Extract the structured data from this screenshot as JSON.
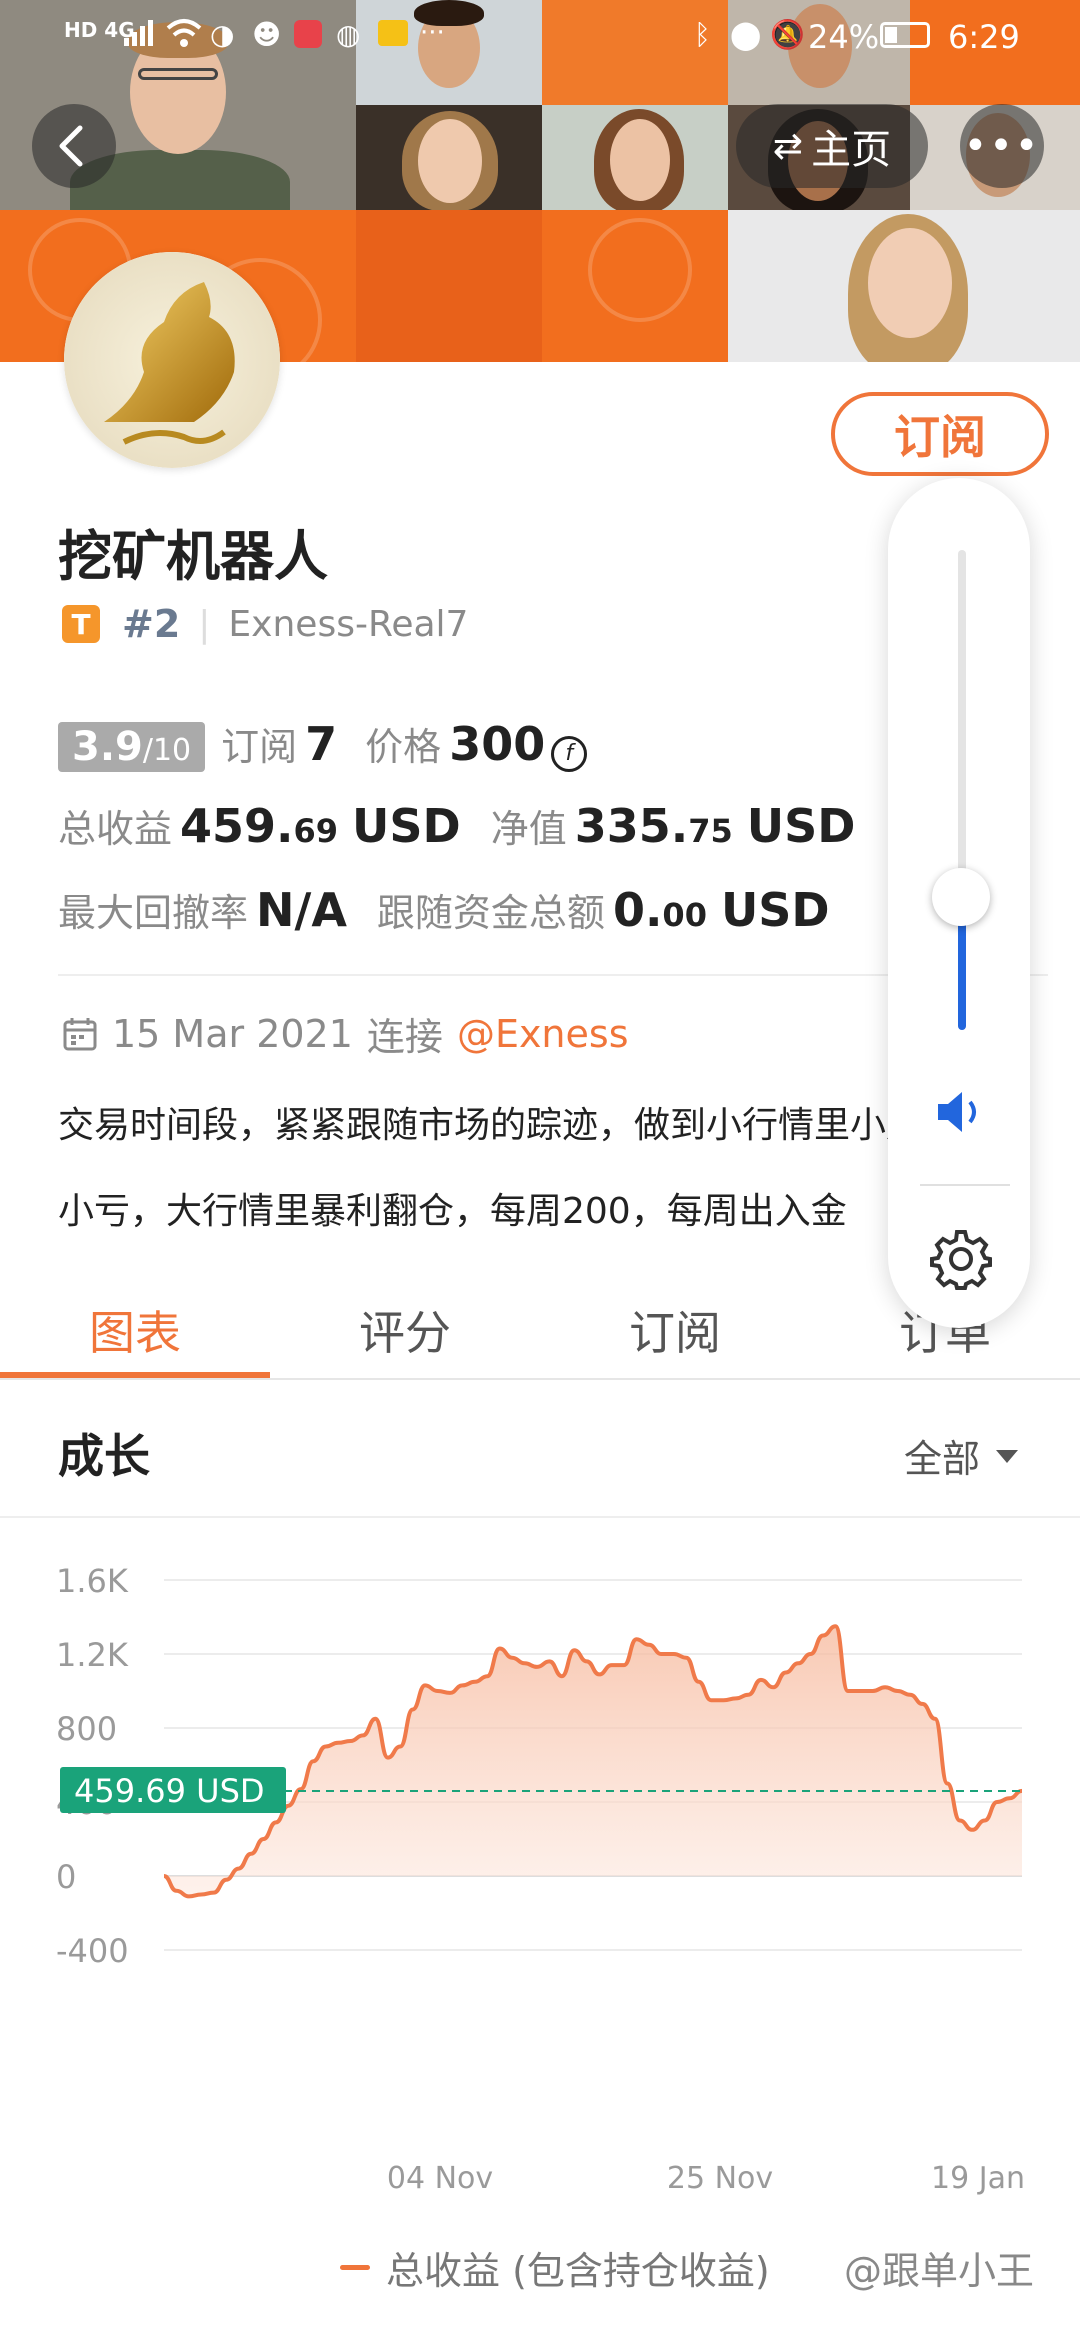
{
  "status_bar": {
    "network_left": "HD 4G",
    "battery_percent": "24%",
    "time": "6:29"
  },
  "header": {
    "home_label": "主页"
  },
  "profile": {
    "subscribe_label": "订阅",
    "title": "挖矿机器人",
    "badge_letter": "T",
    "rank": "#2",
    "account": "Exness-Real7",
    "score": "3.9",
    "score_max": "/10",
    "subscribe_count_label": "订阅",
    "subscribe_count": "7",
    "price_label": "价格",
    "price": "300",
    "total_profit_label": "总收益",
    "total_profit_int": "459.",
    "total_profit_dec": "69",
    "total_profit_unit": "USD",
    "equity_label": "净值",
    "equity_int": "335.",
    "equity_dec": "75",
    "equity_unit": "USD",
    "drawdown_label": "最大回撤率",
    "drawdown": "N/A",
    "follow_funds_label": "跟随资金总额",
    "follow_funds_int": "0.",
    "follow_funds_dec": "00",
    "follow_funds_unit": "USD",
    "date": "15 Mar 2021",
    "connect_label": "连接",
    "broker_link": "@Exness",
    "desc_line1": "交易时间段，紧紧跟随市场的踪迹，做到小行情里小赚",
    "desc_line2": "小亏，大行情里暴利翻仓，每周200，每周出入金"
  },
  "tabs": [
    {
      "label": "图表",
      "active": true
    },
    {
      "label": "评分",
      "active": false
    },
    {
      "label": "订阅",
      "active": false
    },
    {
      "label": "订单",
      "active": false
    }
  ],
  "section": {
    "title": "成长",
    "range": "全部"
  },
  "chart_data": {
    "type": "area",
    "y_ticks": [
      "1.6K",
      "1.2K",
      "800",
      "400",
      "0",
      "-400"
    ],
    "x_ticks": [
      "04 Nov",
      "25 Nov",
      "19 Jan"
    ],
    "ylim": [
      -400,
      1600
    ],
    "current_value_label": "459.69 USD",
    "current_value": 459.69,
    "series": [
      {
        "name": "总收益 (包含持仓收益)",
        "values": [
          0,
          -80,
          -110,
          -100,
          -90,
          -20,
          40,
          120,
          200,
          290,
          380,
          470,
          620,
          700,
          720,
          730,
          760,
          850,
          640,
          700,
          900,
          1030,
          1000,
          990,
          1030,
          1050,
          1080,
          1230,
          1180,
          1150,
          1130,
          1160,
          1080,
          1220,
          1160,
          1090,
          1140,
          1140,
          1280,
          1250,
          1200,
          1200,
          1180,
          1050,
          950,
          950,
          960,
          980,
          1060,
          1020,
          1100,
          1150,
          1200,
          1300,
          1350,
          1000,
          1000,
          1000,
          1020,
          1000,
          980,
          930,
          850,
          500,
          300,
          250,
          300,
          400,
          420,
          460
        ]
      }
    ],
    "legend": "总收益 (包含持仓收益)",
    "colors": {
      "line": "#f07a4a",
      "fill_top": "#f6b79a",
      "fill_bottom": "#fde9e0",
      "marker": "#1aa37a"
    }
  },
  "watermark": "@跟单小王",
  "colors": {
    "accent": "#f0753a",
    "volume_blue": "#2266dd"
  }
}
